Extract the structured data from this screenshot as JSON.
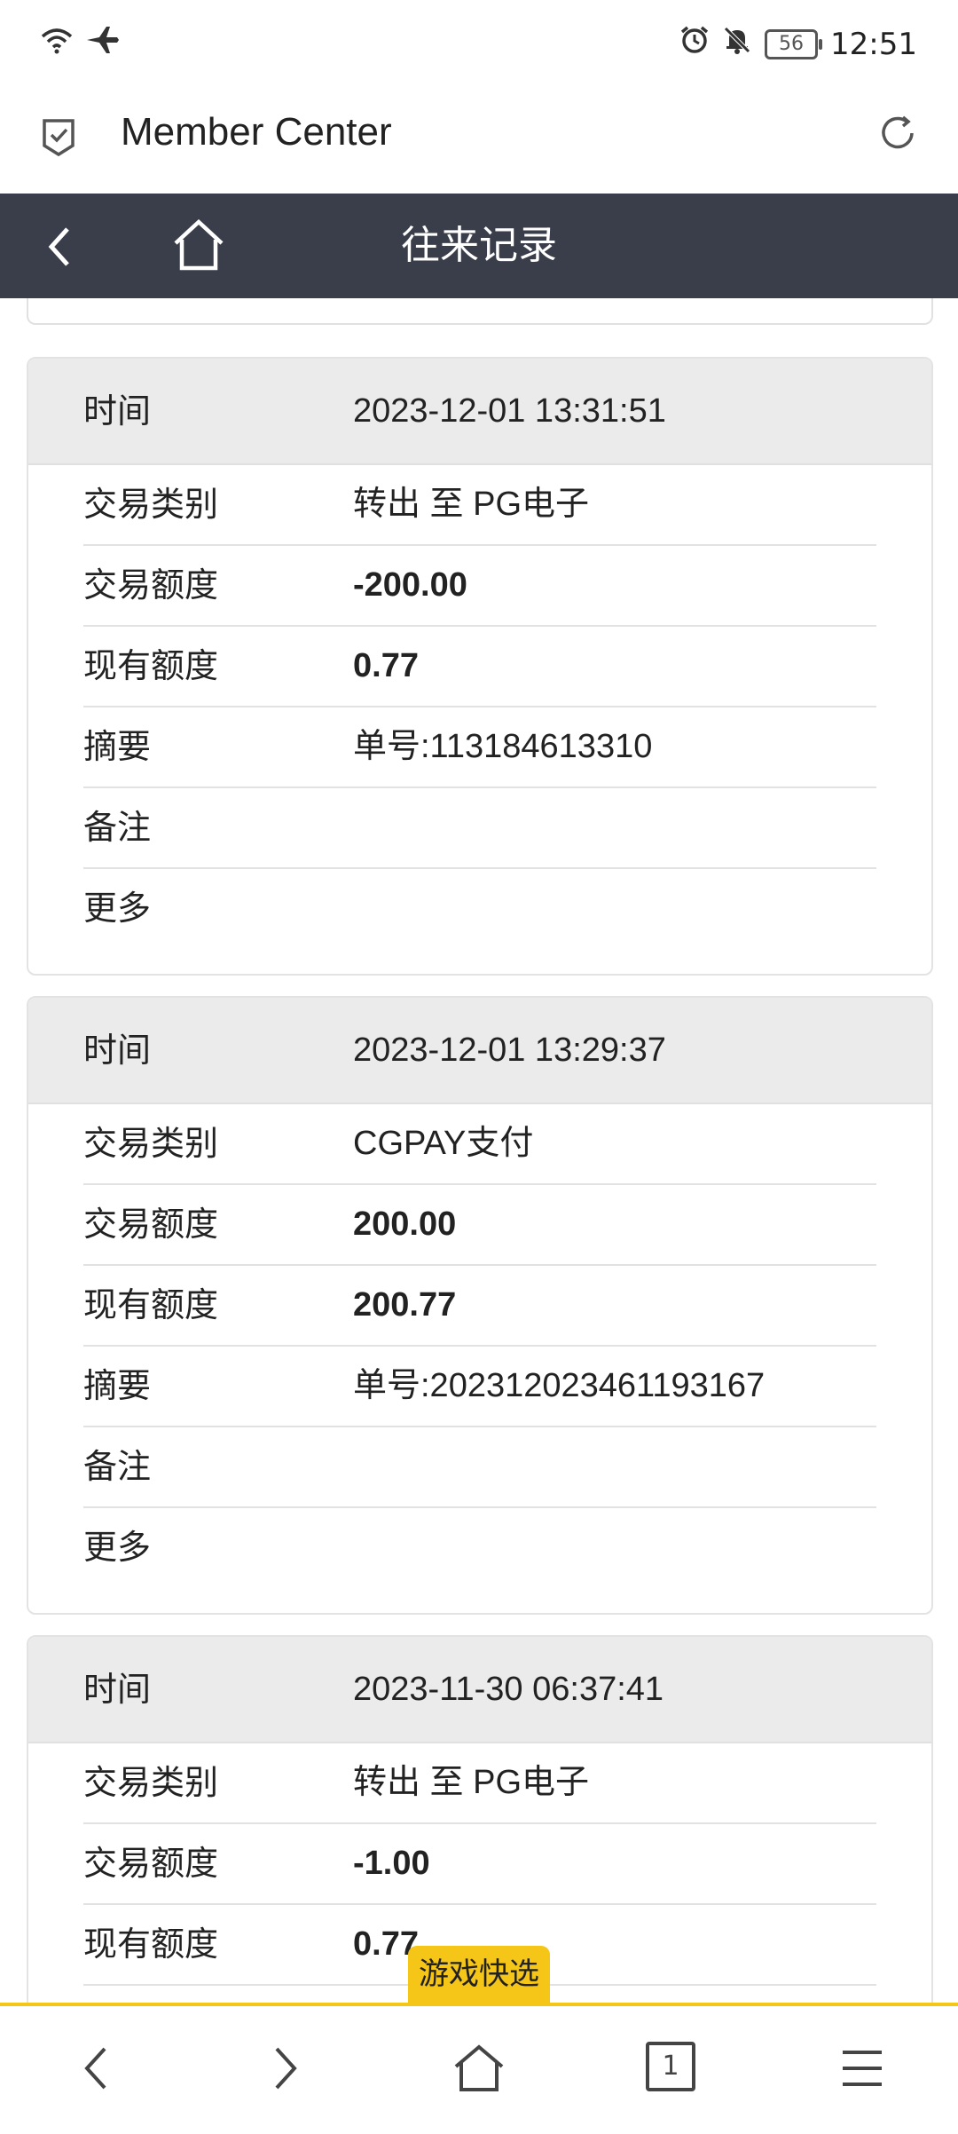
{
  "status_bar": {
    "time": "12:51",
    "battery": "56",
    "icons": [
      "wifi-icon",
      "airplane-icon",
      "alarm-icon",
      "bell-off-icon"
    ]
  },
  "browser": {
    "title": "Member Center",
    "icons": [
      "shield-check-icon",
      "reload-icon"
    ]
  },
  "nav": {
    "title": "往来记录",
    "icons": [
      "back-chevron-icon",
      "home-icon"
    ]
  },
  "labels": {
    "time": "时间",
    "type": "交易类别",
    "amount": "交易额度",
    "balance": "现有额度",
    "summary": "摘要",
    "note": "备注",
    "more": "更多"
  },
  "records": [
    {
      "time": "2023-12-01 13:31:51",
      "type": "转出 至 PG电子",
      "amount": "-200.00",
      "balance": "0.77",
      "summary": "单号:113184613310",
      "note": "",
      "more": ""
    },
    {
      "time": "2023-12-01 13:29:37",
      "type": "CGPAY支付",
      "amount": "200.00",
      "balance": "200.77",
      "summary": "单号:202312023461193167",
      "note": "",
      "more": ""
    },
    {
      "time": "2023-11-30 06:37:41",
      "type": "转出 至 PG电子",
      "amount": "-1.00",
      "balance": "0.77"
    }
  ],
  "floating_tab": "游戏快选",
  "bottom_bar": {
    "tab_count": "1",
    "icons": [
      "back-icon",
      "forward-icon",
      "home-icon",
      "tabs-icon",
      "menu-icon"
    ]
  },
  "colors": {
    "nav_bg": "#3a3d4a",
    "accent": "#f5c518",
    "card_head_bg": "#ebebeb"
  }
}
